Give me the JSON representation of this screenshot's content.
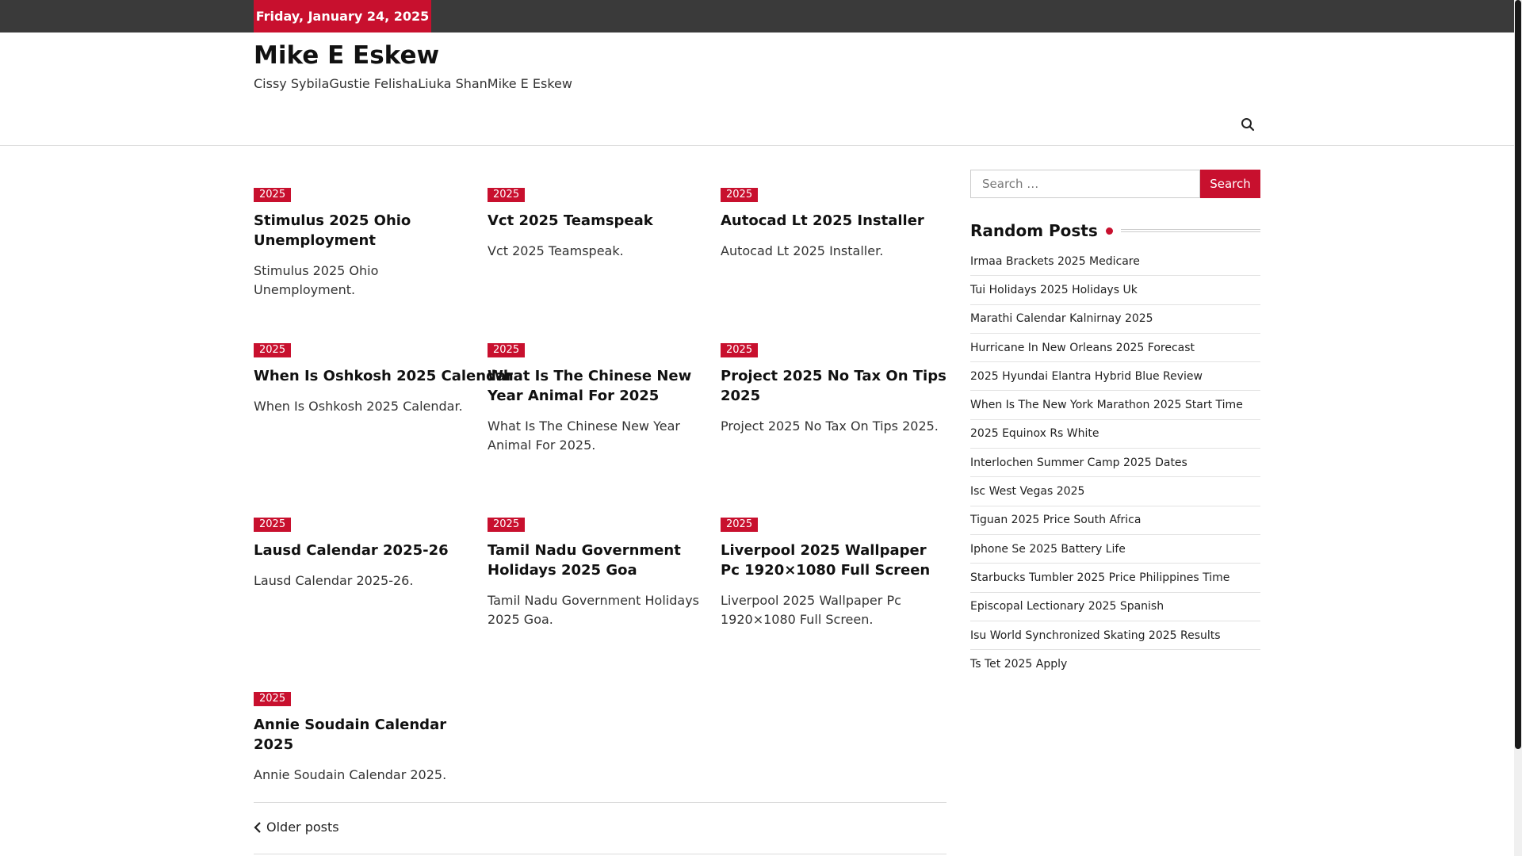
{
  "topbar": {
    "date": "Friday, January 24, 2025"
  },
  "header": {
    "title": "Mike E Eskew",
    "tagline": "Cissy SybilaGustie FelishaLiuka ShanMike E Eskew"
  },
  "icons": {
    "nav_search": "search-icon",
    "older_chevron": "chevron-left-icon"
  },
  "colors": {
    "accent": "#c8102e",
    "topbar": "#3a3a3a"
  },
  "posts": [
    {
      "category": "2025",
      "title": "Stimulus 2025 Ohio Unemployment",
      "excerpt": "Stimulus 2025 Ohio Unemployment."
    },
    {
      "category": "2025",
      "title": "Vct 2025 Teamspeak",
      "excerpt": "Vct 2025 Teamspeak."
    },
    {
      "category": "2025",
      "title": "Autocad Lt 2025 Installer",
      "excerpt": "Autocad Lt 2025 Installer."
    },
    {
      "category": "2025",
      "title": "When Is Oshkosh 2025 Calendar",
      "excerpt": "When Is Oshkosh 2025 Calendar."
    },
    {
      "category": "2025",
      "title": "What Is The Chinese New Year Animal For 2025",
      "excerpt": "What Is The Chinese New Year Animal For 2025."
    },
    {
      "category": "2025",
      "title": "Project 2025 No Tax On Tips 2025",
      "excerpt": "Project 2025 No Tax On Tips 2025."
    },
    {
      "category": "2025",
      "title": "Lausd Calendar 2025-26",
      "excerpt": "Lausd Calendar 2025-26."
    },
    {
      "category": "2025",
      "title": "Tamil Nadu Government Holidays 2025 Goa",
      "excerpt": "Tamil Nadu Government Holidays 2025 Goa."
    },
    {
      "category": "2025",
      "title": "Liverpool 2025 Wallpaper Pc 1920×1080 Full Screen",
      "excerpt": "Liverpool 2025 Wallpaper Pc 1920×1080 Full Screen."
    },
    {
      "category": "2025",
      "title": "Annie Soudain Calendar 2025",
      "excerpt": "Annie Soudain Calendar 2025."
    }
  ],
  "pagination": {
    "older_label": "Older posts"
  },
  "sidebar": {
    "search": {
      "placeholder": "Search …",
      "button_label": "Search"
    },
    "random_title": "Random Posts",
    "random_posts": [
      "Irmaa Brackets 2025 Medicare",
      "Tui Holidays 2025 Holidays Uk",
      "Marathi Calendar Kalnirnay 2025",
      "Hurricane In New Orleans 2025 Forecast",
      "2025 Hyundai Elantra Hybrid Blue Review",
      "When Is The New York Marathon 2025 Start Time",
      "2025 Equinox Rs White",
      "Interlochen Summer Camp 2025 Dates",
      "Isc West Vegas 2025",
      "Tiguan 2025 Price South Africa",
      "Iphone Se 2025 Battery Life",
      "Starbucks Tumbler 2025 Price Philippines Time",
      "Episcopal Lectionary 2025 Spanish",
      "Isu World Synchronized Skating 2025 Results",
      "Ts Tet 2025 Apply"
    ]
  }
}
